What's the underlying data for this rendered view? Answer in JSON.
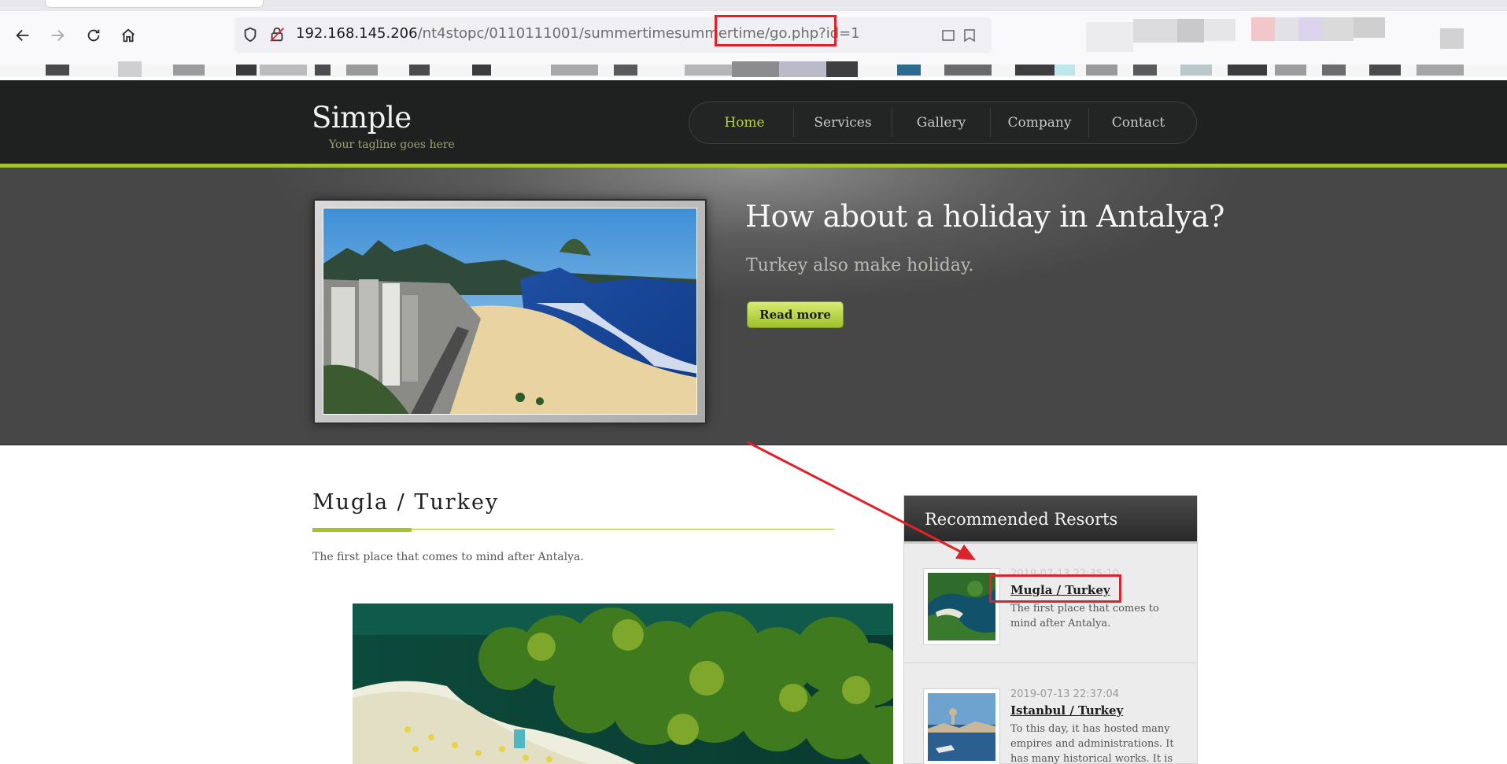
{
  "browser": {
    "url_host": "192.168.145.206",
    "url_path": "/nt4stopc/0110111001/summertimesummertime/go.php?id=1"
  },
  "site": {
    "brand": "Simple",
    "tagline": "Your tagline goes here",
    "nav": [
      "Home",
      "Services",
      "Gallery",
      "Company",
      "Contact"
    ],
    "active_nav": "Home"
  },
  "hero": {
    "heading": "How about a holiday in Antalya?",
    "subheading": "Turkey also make holiday.",
    "button": "Read more"
  },
  "post": {
    "title": "Mugla / Turkey",
    "excerpt": "The first place that comes to mind after Antalya."
  },
  "sidebar": {
    "title": "Recommended Resorts",
    "items": [
      {
        "date": "2019-07-13 22:35:10",
        "title": "Mugla / Turkey",
        "desc": "The first place that comes to mind after Antalya."
      },
      {
        "date": "2019-07-13 22:37:04",
        "title": "Istanbul / Turkey",
        "desc": "To this day, it has hosted many empires and administrations. It has many historical works. It is"
      }
    ]
  },
  "colors": {
    "accent_green": "#a6c22d",
    "header_dark": "#1f2120",
    "annotation_red": "#e0202a"
  },
  "icons": [
    "back-arrow-icon",
    "forward-arrow-icon",
    "reload-icon",
    "home-icon",
    "shield-icon",
    "insecure-lock-icon"
  ]
}
